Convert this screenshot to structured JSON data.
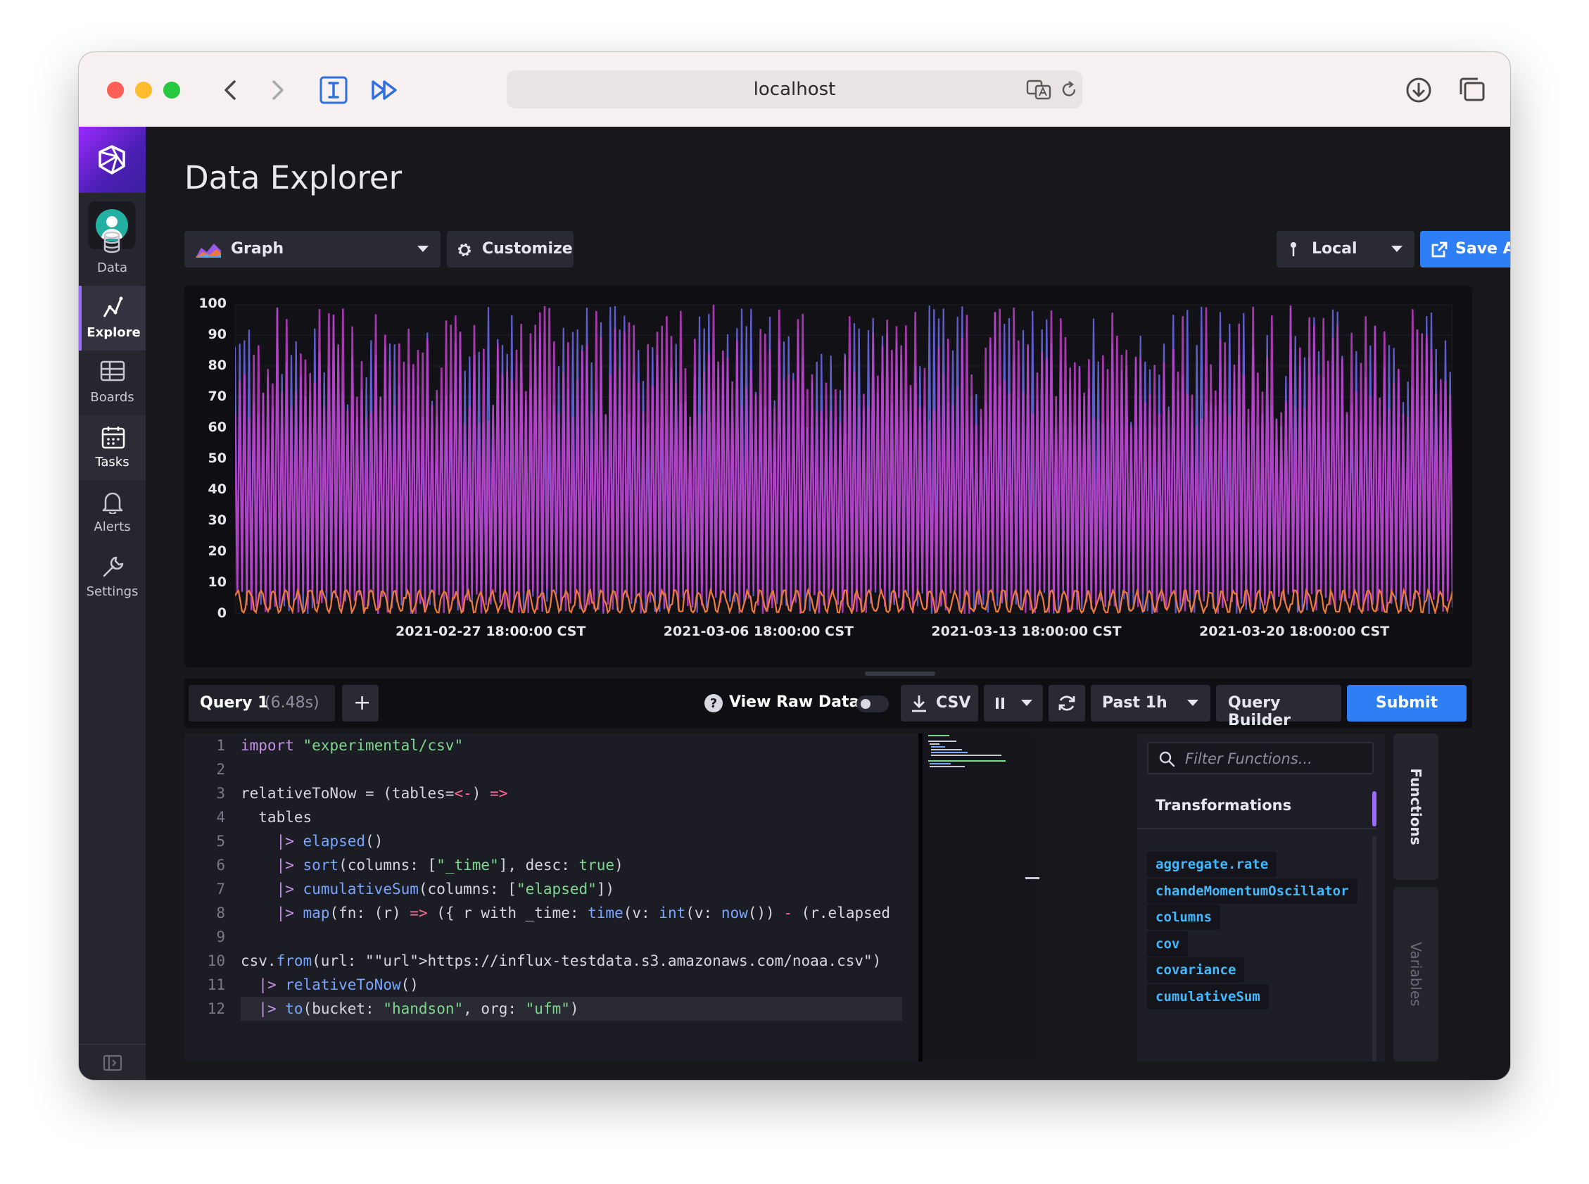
{
  "browser": {
    "url": "localhost"
  },
  "sidebar": {
    "items": [
      {
        "label": "Data",
        "icon": "database-icon"
      },
      {
        "label": "Explore",
        "icon": "explore-graph-icon",
        "active": true
      },
      {
        "label": "Boards",
        "icon": "dashboard-grid-icon"
      },
      {
        "label": "Tasks",
        "icon": "calendar-icon"
      },
      {
        "label": "Alerts",
        "icon": "bell-icon"
      },
      {
        "label": "Settings",
        "icon": "wrench-icon"
      }
    ]
  },
  "header": {
    "title": "Data Explorer"
  },
  "toolbar": {
    "graph_type": "Graph",
    "customize": "Customize",
    "timezone": "Local",
    "save_as": "Save As"
  },
  "chart_data": {
    "type": "line",
    "title": "",
    "xlabel": "",
    "ylabel": "",
    "ylim": [
      0,
      100
    ],
    "y_ticks": [
      "100",
      "90",
      "80",
      "70",
      "60",
      "50",
      "40",
      "30",
      "20",
      "10",
      "0"
    ],
    "x_ticks": [
      "2021-02-27 18:00:00 CST",
      "2021-03-06 18:00:00 CST",
      "2021-03-13 18:00:00 CST",
      "2021-03-20 18:00:00 CST"
    ],
    "grid": true,
    "legend": "none",
    "series": [
      {
        "color": "#c040c8",
        "range": [
          0,
          100
        ]
      },
      {
        "color": "#6f6cf0",
        "range": [
          0,
          100
        ]
      },
      {
        "color": "#f07a3a",
        "range": [
          0,
          8
        ]
      }
    ]
  },
  "query_bar": {
    "query_tab": "Query 1",
    "query_time": "(6.48s)",
    "add": "+",
    "view_raw": "View Raw Data",
    "csv": "CSV",
    "time_range": "Past 1h",
    "query_builder": "Query Builder",
    "submit": "Submit"
  },
  "editor": {
    "line_numbers": [
      "1",
      "2",
      "3",
      "4",
      "5",
      "6",
      "7",
      "8",
      "9",
      "10",
      "11",
      "12"
    ],
    "lines": [
      "import \"experimental/csv\"",
      "",
      "relativeToNow = (tables=<-) =>",
      "  tables",
      "    |> elapsed()",
      "    |> sort(columns: [\"_time\"], desc: true)",
      "    |> cumulativeSum(columns: [\"elapsed\"])",
      "    |> map(fn: (r) => ({ r with _time: time(v: int(v: now()) - (r.elapsed",
      "",
      "csv.from(url: \"https://influx-testdata.s3.amazonaws.com/noaa.csv\")",
      "  |> relativeToNow()",
      "  |> to(bucket: \"handson\", org: \"ufm\")"
    ]
  },
  "functions": {
    "filter_placeholder": "Filter Functions...",
    "category": "Transformations",
    "items": [
      "aggregate.rate",
      "chandeMomentumOscillator",
      "columns",
      "cov",
      "covariance",
      "cumulativeSum"
    ],
    "tabs": {
      "functions": "Functions",
      "variables": "Variables"
    }
  }
}
